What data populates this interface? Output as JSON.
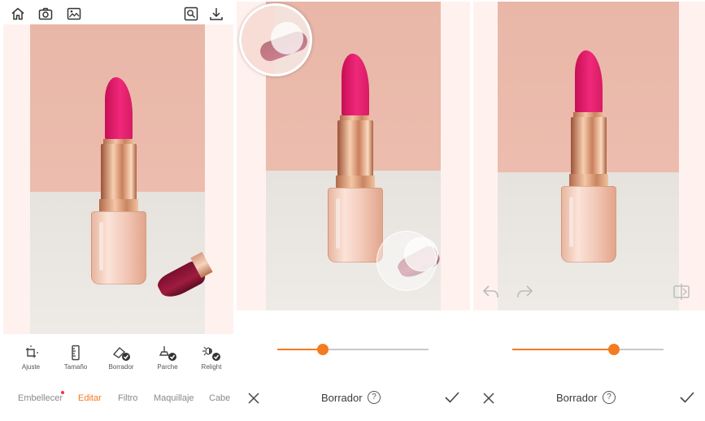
{
  "panel1": {
    "top_icons": [
      "home-icon",
      "camera-icon",
      "image-compare-icon"
    ],
    "top_right_icons": [
      "search-zoom-icon",
      "download-icon"
    ],
    "tools": [
      {
        "label": "Ajuste",
        "icon": "adjust-icon"
      },
      {
        "label": "Tamaño",
        "icon": "ruler-icon"
      },
      {
        "label": "Borrador",
        "icon": "eraser-icon"
      },
      {
        "label": "Parche",
        "icon": "patch-icon"
      },
      {
        "label": "Relight",
        "icon": "relight-icon"
      }
    ],
    "nav": [
      {
        "label": "Embellecer",
        "active": false,
        "badge": true
      },
      {
        "label": "Editar",
        "active": true
      },
      {
        "label": "Filtro",
        "active": false
      },
      {
        "label": "Maquillaje",
        "active": false
      },
      {
        "label": "Cabe",
        "active": false
      }
    ]
  },
  "panel2": {
    "title": "Borrador",
    "help_symbol": "?",
    "slider_value": 0.3
  },
  "panel3": {
    "title": "Borrador",
    "help_symbol": "?",
    "slider_value": 0.7
  },
  "colors": {
    "accent": "#f47b20",
    "badge": "#ff2a4d"
  }
}
